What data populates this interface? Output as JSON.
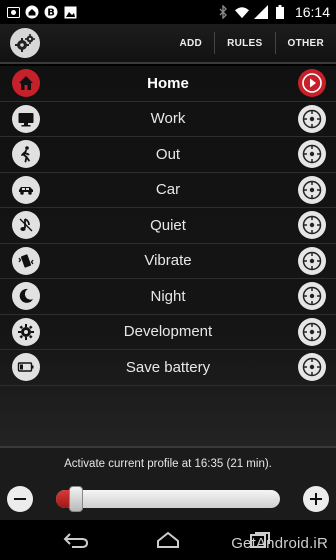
{
  "statusbar": {
    "time": "16:14",
    "left_icons": [
      "photo-icon",
      "home-icon",
      "bitcoin-icon",
      "image-icon"
    ],
    "right_icons": [
      "bluetooth-icon",
      "wifi-icon",
      "signal-icon",
      "battery-icon"
    ]
  },
  "actionbar": {
    "logo": "gears-icon",
    "actions": [
      {
        "label": "ADD"
      },
      {
        "label": "RULES"
      },
      {
        "label": "OTHER"
      }
    ]
  },
  "profiles": [
    {
      "label": "Home",
      "icon": "home-icon",
      "active": true
    },
    {
      "label": "Work",
      "icon": "monitor-icon",
      "active": false
    },
    {
      "label": "Out",
      "icon": "walk-icon",
      "active": false
    },
    {
      "label": "Car",
      "icon": "car-icon",
      "active": false
    },
    {
      "label": "Quiet",
      "icon": "music-note-icon",
      "active": false
    },
    {
      "label": "Vibrate",
      "icon": "vibrate-icon",
      "active": false
    },
    {
      "label": "Night",
      "icon": "moon-icon",
      "active": false
    },
    {
      "label": "Development",
      "icon": "gear-icon",
      "active": false
    },
    {
      "label": "Save battery",
      "icon": "battery-icon",
      "active": false
    }
  ],
  "schedule": {
    "text": "Activate current profile at 16:35 (21 min).",
    "slider_fraction": 0.06
  },
  "watermark": "GetAndroid.iR",
  "colors": {
    "accent": "#c6202b",
    "background": "#111111",
    "icon_bg": "#e1e1e1"
  }
}
